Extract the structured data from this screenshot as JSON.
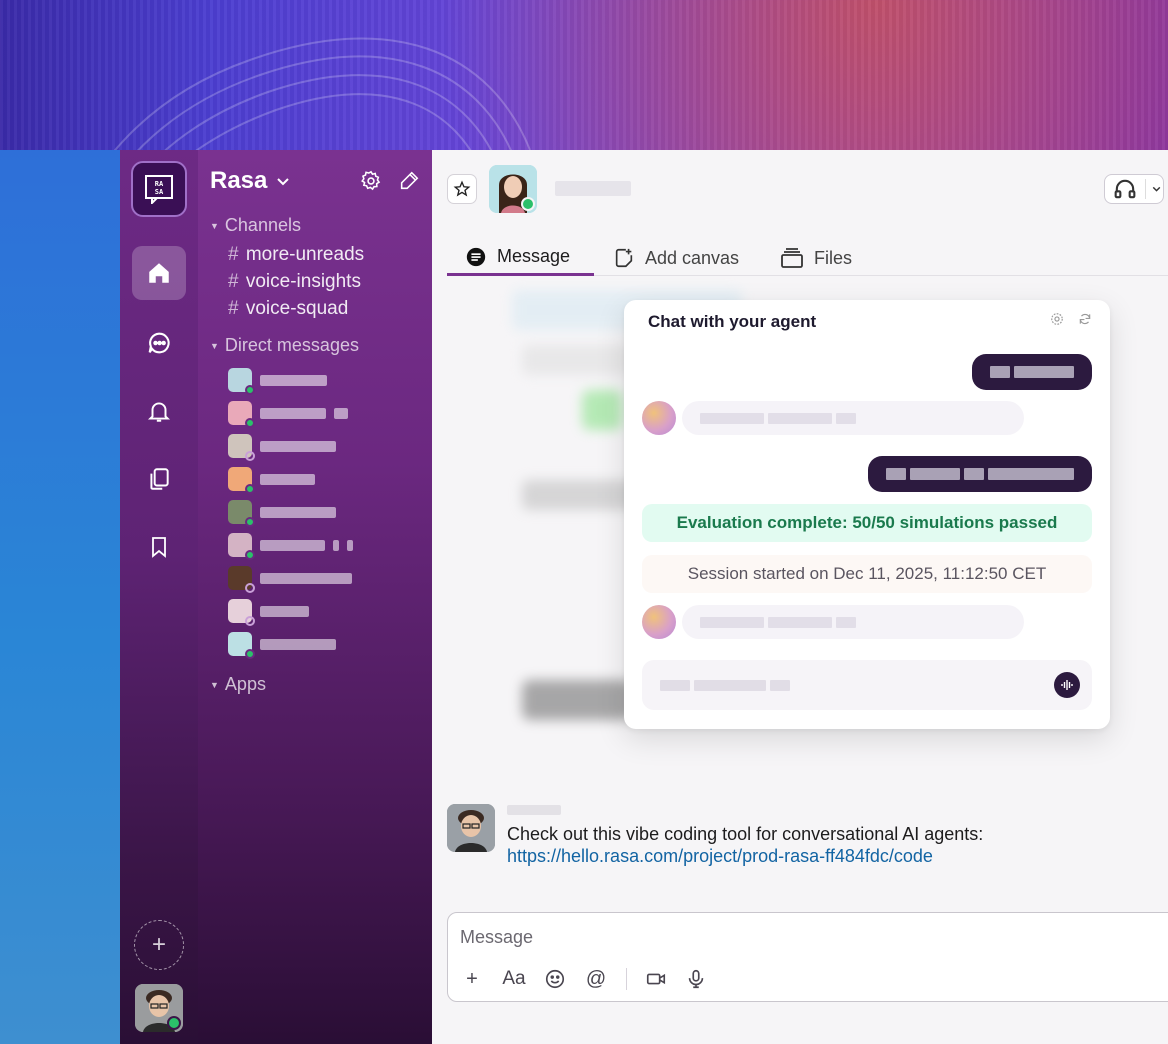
{
  "workspace": {
    "name": "Rasa"
  },
  "sidebar": {
    "sections": {
      "channels": "Channels",
      "direct_messages": "Direct messages",
      "apps": "Apps"
    },
    "channels": [
      {
        "name": "more-unreads"
      },
      {
        "name": "voice-insights"
      },
      {
        "name": "voice-squad"
      }
    ]
  },
  "rail": {
    "items": [
      "home-icon",
      "dms-icon",
      "bell-icon",
      "files-icon",
      "bookmark-icon"
    ]
  },
  "tabs": [
    {
      "label": "Message"
    },
    {
      "label": "Add canvas"
    },
    {
      "label": "Files"
    }
  ],
  "agent_panel": {
    "title": "Chat with your agent",
    "evaluation": "Evaluation complete: 50/50 simulations passed",
    "session": "Session started on Dec 11, 2025, 11:12:50 CET"
  },
  "message": {
    "text": "Check out this vibe coding tool for conversational AI agents:",
    "link": "https://hello.rasa.com/project/prod-rasa-ff484fdc/code"
  },
  "composer": {
    "placeholder": "Message"
  },
  "colors": {
    "sidebar": "#6b2880",
    "accent": "#7a3290",
    "eval_bg": "#e2fbf1",
    "eval_text": "#1a7a4d",
    "link": "#1264a3"
  }
}
